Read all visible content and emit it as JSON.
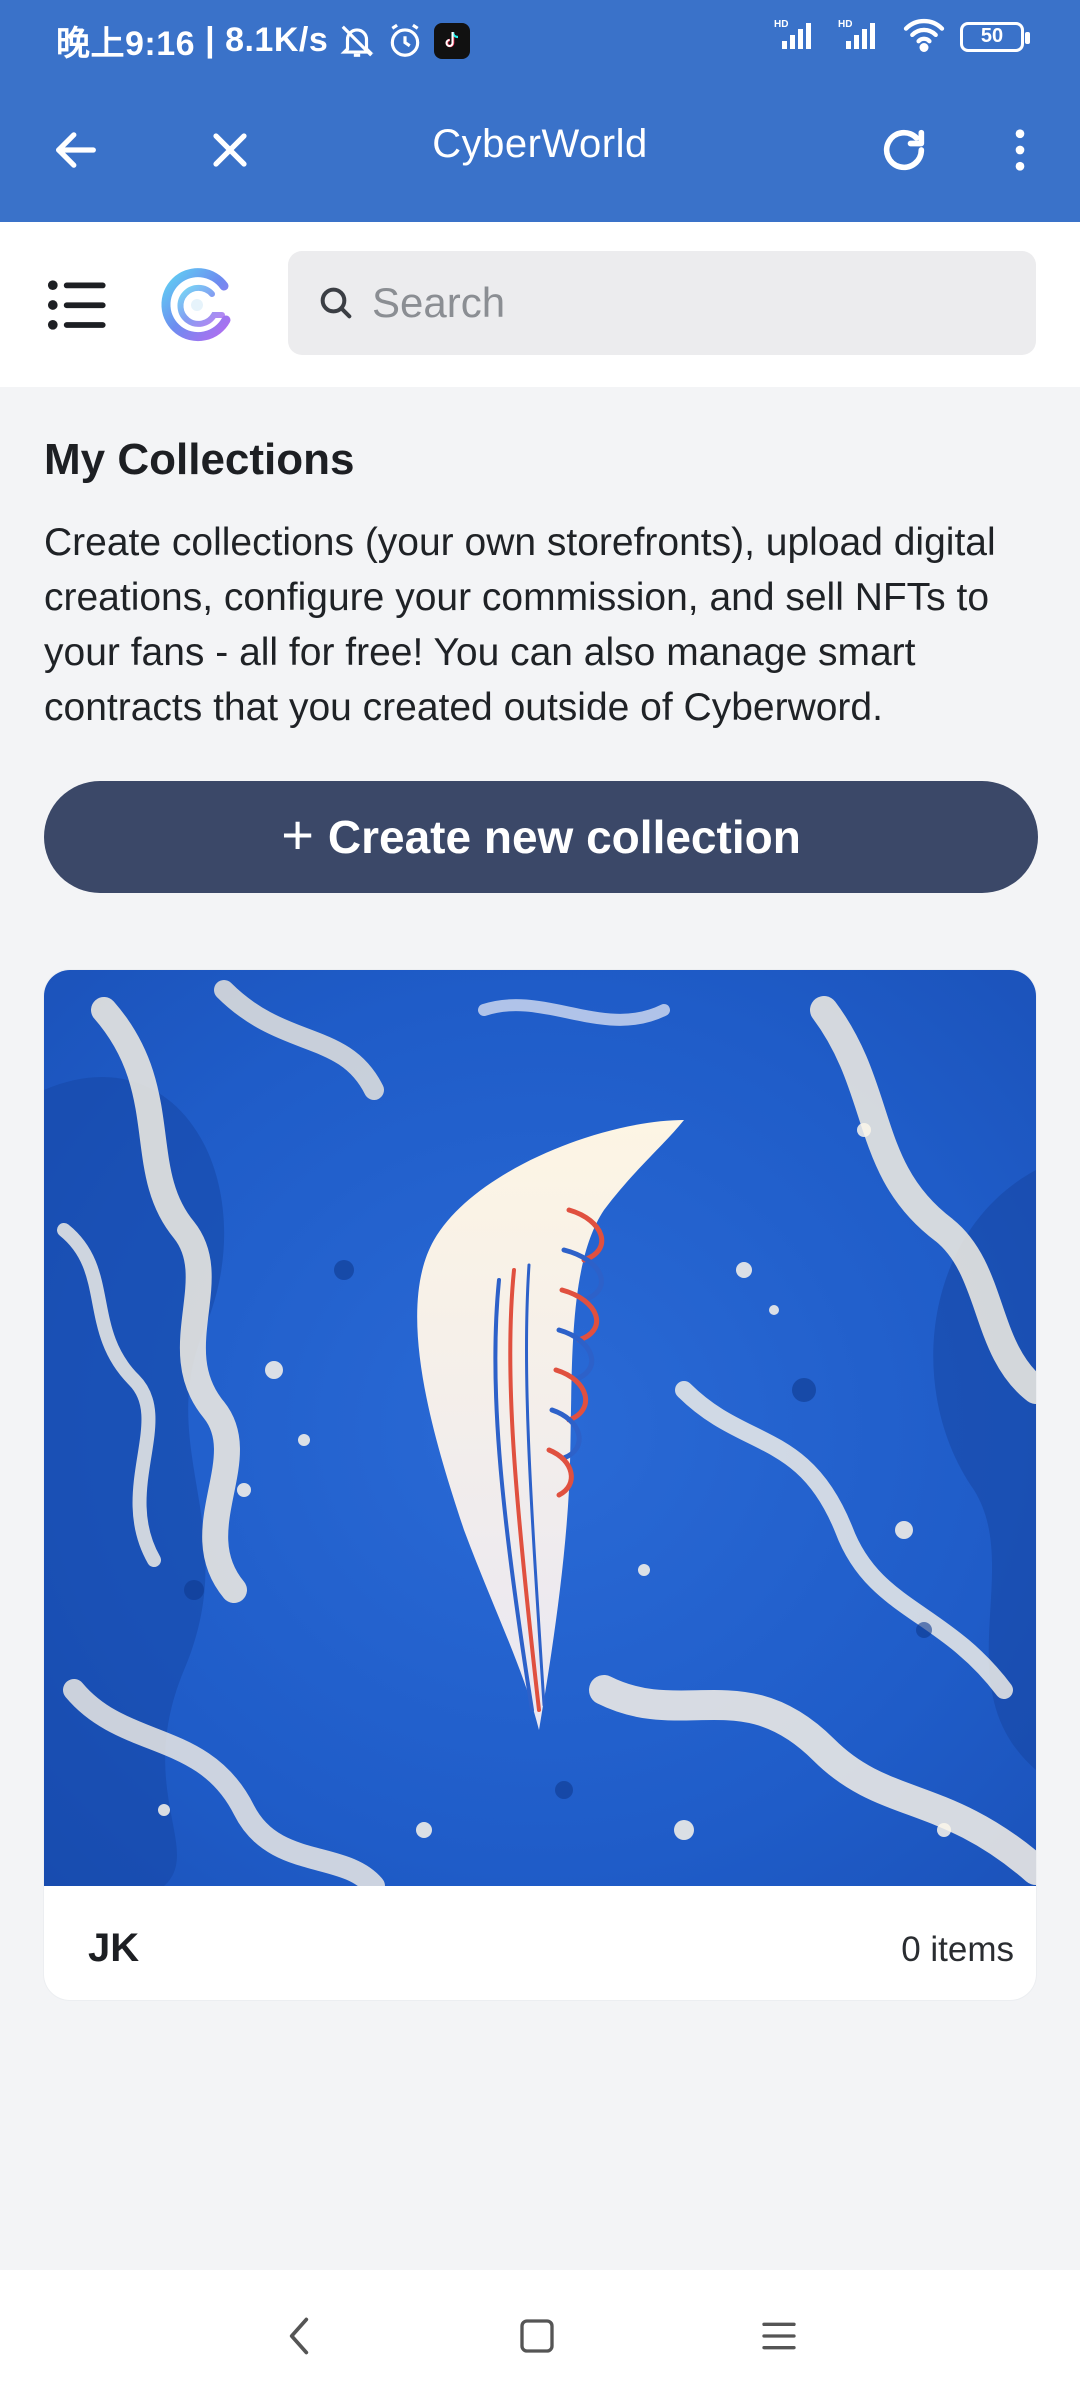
{
  "status_bar": {
    "time": "晚上9:16",
    "speed": "8.1K/s",
    "battery": "50"
  },
  "app_bar": {
    "title": "CyberWorld"
  },
  "header": {
    "search_placeholder": "Search"
  },
  "main": {
    "heading": "My Collections",
    "description": "Create collections (your own storefronts), upload digital creations, configure your commission, and sell NFTs to your fans - all for free! You can also manage smart contracts that you created outside of Cyberword.",
    "create_button_label": "Create new collection"
  },
  "collections": [
    {
      "name": "JK",
      "count": "0 items"
    }
  ],
  "colors": {
    "app_bar": "#3a72c9",
    "create_button": "#3b4868",
    "background": "#f3f4f6"
  }
}
